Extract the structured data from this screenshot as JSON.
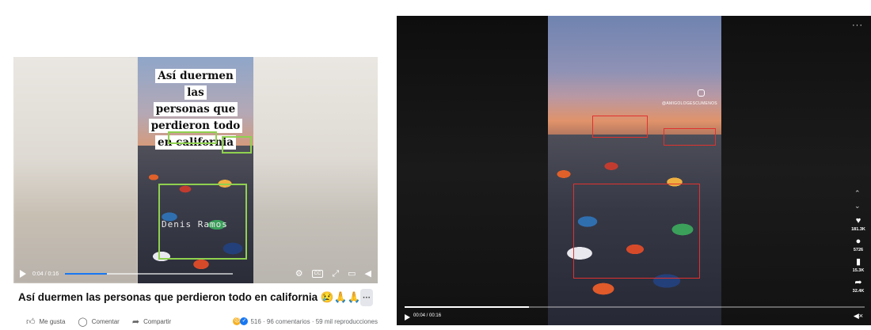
{
  "left_post": {
    "caption_lines": [
      "Así duermen las",
      "personas que",
      "perdieron todo",
      "en california"
    ],
    "watermark": "Denis Ramos",
    "player": {
      "time": "0:04 / 0:16",
      "progress": 0.25
    },
    "title": "Así duermen las personas que perdieron todo en california 😢🙏🙏",
    "more_label": "···",
    "actions": {
      "like": "Me gusta",
      "comment": "Comentar",
      "share": "Compartir"
    },
    "stats": "516 · 96 comentarios · 59 mil reproducciones",
    "colors": {
      "highlight_box": "#8fd14f",
      "progress": "#1877f2"
    },
    "icons": [
      "play-icon",
      "settings-icon",
      "captions-icon",
      "fullscreen-icon",
      "pip-icon",
      "volume-icon",
      "thumbs-up-icon",
      "comment-icon",
      "share-icon"
    ]
  },
  "right_viewer": {
    "handle": "@AMIGOLOGESCUMENOS",
    "player": {
      "time": "00:04 / 00:16",
      "progress": 0.27
    },
    "menu_label": "···",
    "nav": {
      "up": "⌃",
      "down": "⌄"
    },
    "side_actions": [
      {
        "icon": "heart-icon",
        "glyph": "♥",
        "count": "181.3K"
      },
      {
        "icon": "comment-icon",
        "glyph": "●",
        "count": "5726"
      },
      {
        "icon": "bookmark-icon",
        "glyph": "▮",
        "count": "15.3K"
      },
      {
        "icon": "share-icon",
        "glyph": "➦",
        "count": "32.4K"
      }
    ],
    "colors": {
      "highlight_box": "#e0322f"
    }
  }
}
